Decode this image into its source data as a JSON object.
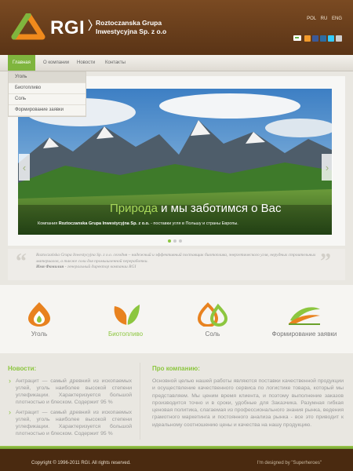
{
  "header": {
    "logo_text": "RGI",
    "company_line1": "Roztoczanska Grupa",
    "company_line2": "Inwestycyjna Sp. z o.o",
    "languages": [
      "POL",
      "RU",
      "ENG"
    ]
  },
  "nav": {
    "items": [
      "Главная",
      "О компании",
      "Новости",
      "Контакты"
    ]
  },
  "dropdown": {
    "items": [
      "Уголь",
      "Биотопливо",
      "Соль",
      "Формирование заявки"
    ]
  },
  "slider": {
    "caption_highlight": "Природа",
    "caption_rest": " и мы заботимся о Вас",
    "sub_prefix": "Компания ",
    "sub_company": "Roztoczanska Grupa Inwestycyjna Sp. z o.o.",
    "sub_suffix": " - поставки угля в Польшу и страны Европы.",
    "prev_label": "‹",
    "next_label": "›"
  },
  "quote": {
    "text": "Roztoczańska Grupa Inwestycyjna Sp. z o.o. сегодня – надежный и эффективный поставщик биотоплива, энергетического угля, нерудных строительных материалов, а также соли для промышленной переработки.",
    "author": "Имя Фамилия",
    "author_role": " - генеральный директор компании RGI"
  },
  "features": [
    {
      "label": "Уголь"
    },
    {
      "label": "Биотопливо"
    },
    {
      "label": "Соль"
    },
    {
      "label": "Формирование заявки"
    }
  ],
  "news": {
    "title": "Новости:",
    "items": [
      "Антрацит — самый древний из ископаемых углей, уголь наиболее высокой степени углефикации. Характеризуется большой плотностью и блеском. Содержит 95 %",
      "Антрацит — самый древний из ископаемых углей, уголь наиболее высокой степени углефикации. Характеризуется большой плотностью и блеском. Содержит 95 %"
    ]
  },
  "about": {
    "title": "Про компанию:",
    "text": "Основной целью нашей работы являются поставки качественной продукции и осуществление качественного сервиса по логистике товара, который мы представляем. Мы ценим время клиента, и поэтому выполнение заказов производится точно и в сроки, удобные для Заказчика. Разумная гибкая ценовая политика, слагаемая из профессионального знания рынка, ведения грамотного маркетинга и постоянного анализа рынка - все это приводит к идеальному соотношению цены и качества на нашу продукцию."
  },
  "footer": {
    "copyright": "Copyright © 1996-2011 RGI. All rights reserved.",
    "designed": "I'm designed by \"Superheroes\""
  },
  "colors": {
    "accent": "#8cc63f",
    "header_brown": "#6a3e1b",
    "orange": "#e8821f"
  }
}
